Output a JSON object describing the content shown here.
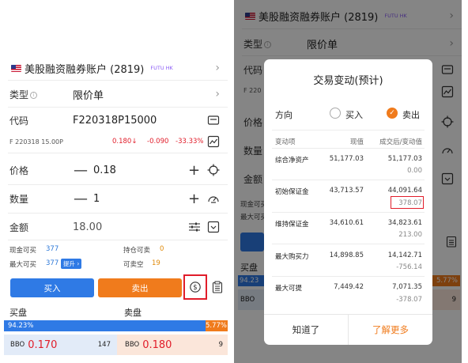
{
  "account": {
    "name": "美股融资融券账户 (2819)",
    "tag": "FUTU HK"
  },
  "order": {
    "type_label": "类型",
    "type_value": "限价单",
    "code_label": "代码",
    "code_value": "F220318P15000",
    "quote": {
      "name": "F 220318 15.00P",
      "price": "0.180",
      "change": "-0.090",
      "change_pct": "-33.33%"
    },
    "price_label": "价格",
    "price_value": "0.18",
    "qty_label": "数量",
    "qty_value": "1",
    "amount_label": "金额",
    "amount_value": "18.00"
  },
  "funds": {
    "cash_buy_label": "现金可买",
    "cash_buy_value": "377",
    "hold_sell_label": "持仓可卖",
    "hold_sell_value": "0",
    "max_buy_label": "最大可买",
    "max_buy_value": "377",
    "upgrade": "提升",
    "short_label": "可卖空",
    "short_value": "19"
  },
  "actions": {
    "buy": "买入",
    "sell": "卖出"
  },
  "book": {
    "bid_label": "买盘",
    "ask_label": "卖盘",
    "bid_pct": "94.23%",
    "ask_pct": "5.77%",
    "bid_pct_value": 94.23,
    "bbo_label": "BBO",
    "bid_price": "0.170",
    "bid_size": "147",
    "ask_price": "0.180",
    "ask_size": "9"
  },
  "right_bg": {
    "code_short": "F 220",
    "cash_short": "现金可买",
    "maxbuy_short": "最大可买",
    "bid_short": "买盘",
    "bid_pct_short": "94.23",
    "bbo_short": "BBO",
    "ask_pct": "5.77%",
    "ask_size": "9"
  },
  "dialog": {
    "title": "交易变动(预计)",
    "direction_label": "方向",
    "opt_buy": "买入",
    "opt_sell": "卖出",
    "col_item": "变动项",
    "col_now": "现值",
    "col_after": "成交后/变动值",
    "rows": [
      {
        "label": "综合净资产",
        "now": "51,177.03",
        "after": "51,177.03",
        "delta": "0.00"
      },
      {
        "label": "初始保证金",
        "now": "43,713.57",
        "after": "44,091.64",
        "delta": "378.07"
      },
      {
        "label": "维持保证金",
        "now": "34,610.61",
        "after": "34,823.61",
        "delta": "213.00"
      },
      {
        "label": "最大购买力",
        "now": "14,898.85",
        "after": "14,142.71",
        "delta": "-756.14"
      },
      {
        "label": "最大可提",
        "now": "7,449.42",
        "after": "7,071.35",
        "delta": "-378.07"
      }
    ],
    "btn_ok": "知道了",
    "btn_more": "了解更多"
  },
  "colors": {
    "buy": "#2f7ae5",
    "sell": "#f07b1c",
    "down": "#e11d2a",
    "highlight": "#e11d2a"
  }
}
